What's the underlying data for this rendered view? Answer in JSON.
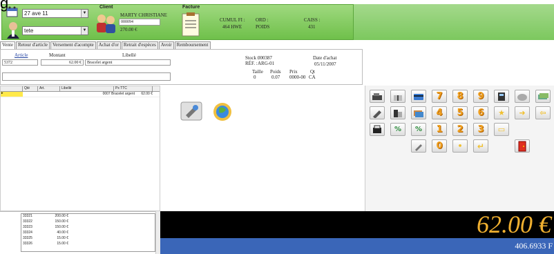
{
  "header": {
    "top_glyph": "g",
    "store_combo": "27 ave 11",
    "user_combo": "tete",
    "client_label": "Client",
    "client_name": "MARTY CHRISTIANE",
    "client_code": "000094",
    "client_amount": "270.00 €",
    "facture_label": "Facture",
    "cumul_line1": "CUMUL FI :",
    "cumul_line2": "464 HWE",
    "ord_line1": "ORD :",
    "ord_line2": "POIDS",
    "caisse_line1": "CAISS :",
    "caisse_line2": "431"
  },
  "tabs": [
    "Vente",
    "Retour d'article",
    "Versement d'acompte",
    "Achat d'or",
    "Retrait d'espèces",
    "Avoir",
    "Remboursement"
  ],
  "sale": {
    "col_article": "Article",
    "col_montant": "Montant",
    "col_libelle": "Libellé",
    "article_value": "5372",
    "montant_value": "62.00 €",
    "libelle_value": "Bracelet argent",
    "stock_label": "Stock :",
    "stock_value": "000387",
    "ref_label": "RÉF. :",
    "ref_value": "ARG-01",
    "date_label": "Date d'achat",
    "date_value": "05/11/2007",
    "taille_label": "Taille",
    "taille_value": "0",
    "poids_label": "Poids",
    "poids_value": "0.07",
    "prix_label": "Prix",
    "prix_value": "0000-00",
    "ca_label": "Qt",
    "ca_value": "CA"
  },
  "grid": {
    "headers": [
      "",
      "Qté",
      "Art.",
      "Libellé",
      "Px TTC"
    ],
    "row": [
      "",
      "",
      "",
      "0007 Bracelet argent",
      "62.00 €"
    ]
  },
  "keypad": {
    "row2_nums": [
      "7",
      "8",
      "9"
    ],
    "row3_nums": [
      "4",
      "5",
      "6"
    ],
    "row4_nums": [
      "1",
      "2",
      "3"
    ],
    "row5_nums": [
      "0"
    ]
  },
  "history": [
    [
      "33321",
      "200.00 €"
    ],
    [
      "33322",
      "150.00 €"
    ],
    [
      "33323",
      "150.00 €"
    ],
    [
      "33324",
      "40.00 €"
    ],
    [
      "33325",
      "15.00 €"
    ],
    [
      "33326",
      "15.00 €"
    ]
  ],
  "totals": {
    "amount": "62.00 €",
    "converted": "406.6933 F"
  },
  "colors": {
    "header_green": "#7cc85e",
    "total_bg": "#000000",
    "total_fg": "#f0b030",
    "convert_bg": "#3a66b8"
  }
}
